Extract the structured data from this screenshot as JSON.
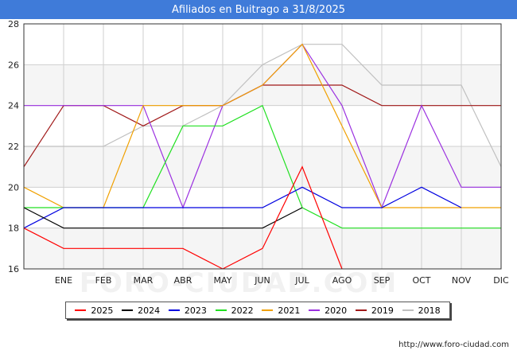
{
  "header": {
    "title": "Afiliados en Buitrago a 31/8/2025"
  },
  "watermark": "FORO-CIUDAD.COM",
  "footer": {
    "url": "http://www.foro-ciudad.com"
  },
  "chart_data": {
    "type": "line",
    "title": "Afiliados en Buitrago a 31/8/2025",
    "categories": [
      "",
      "ENE",
      "FEB",
      "MAR",
      "ABR",
      "MAY",
      "JUN",
      "JUL",
      "AGO",
      "SEP",
      "OCT",
      "NOV",
      "DIC"
    ],
    "ylim": [
      16,
      28
    ],
    "yticks": [
      16,
      18,
      20,
      22,
      24,
      26,
      28
    ],
    "grid": true,
    "legend_position": "bottom",
    "series": [
      {
        "name": "2018",
        "color": "#c0c0c0",
        "values": [
          22,
          22,
          22,
          23,
          23,
          24,
          26,
          27,
          27,
          25,
          25,
          25,
          21
        ]
      },
      {
        "name": "2019",
        "color": "#a01818",
        "values": [
          21,
          24,
          24,
          23,
          24,
          24,
          25,
          25,
          25,
          24,
          24,
          24,
          24
        ]
      },
      {
        "name": "2020",
        "color": "#9b30e0",
        "values": [
          24,
          24,
          24,
          24,
          19,
          24,
          25,
          27,
          24,
          19,
          24,
          20,
          20
        ]
      },
      {
        "name": "2021",
        "color": "#f0a000",
        "values": [
          20,
          19,
          19,
          24,
          24,
          24,
          25,
          27,
          23,
          19,
          19,
          19,
          19
        ]
      },
      {
        "name": "2022",
        "color": "#20e020",
        "values": [
          19,
          19,
          19,
          19,
          23,
          23,
          24,
          19,
          18,
          18,
          18,
          18,
          18
        ]
      },
      {
        "name": "2023",
        "color": "#0000e0",
        "values": [
          18,
          19,
          19,
          19,
          19,
          19,
          19,
          20,
          19,
          19,
          20,
          19,
          null
        ]
      },
      {
        "name": "2024",
        "color": "#000000",
        "values": [
          19,
          18,
          18,
          18,
          18,
          18,
          18,
          19,
          null,
          null,
          null,
          null,
          null
        ]
      },
      {
        "name": "2025",
        "color": "#ff0000",
        "values": [
          18,
          17,
          17,
          17,
          17,
          16,
          17,
          21,
          16,
          null,
          null,
          null,
          null
        ]
      }
    ],
    "legend_order": [
      "2025",
      "2024",
      "2023",
      "2022",
      "2021",
      "2020",
      "2019",
      "2018"
    ]
  }
}
